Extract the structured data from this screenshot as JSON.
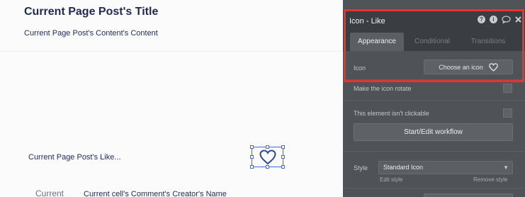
{
  "canvas": {
    "page_title": "Current Page Post's Title",
    "page_content": "Current Page Post's Content's Content",
    "like_text": "Current Page Post's Like...",
    "comment_left": "Current",
    "comment_name": "Current cell's Comment's Creator's Name"
  },
  "panel": {
    "title": "Icon - Like",
    "header_icons": [
      "help-icon",
      "info-icon",
      "comment-icon",
      "close-icon"
    ],
    "tabs": [
      {
        "label": "Appearance",
        "active": true
      },
      {
        "label": "Conditional",
        "active": false
      },
      {
        "label": "Transitions",
        "active": false
      }
    ],
    "icon_row": {
      "label": "Icon",
      "button_label": "Choose an icon",
      "button_icon": "heart-icon"
    },
    "rotate_label": "Make the icon rotate",
    "clickable_label": "This element isn't clickable",
    "workflow_button": "Start/Edit workflow",
    "style_row": {
      "label": "Style",
      "selected": "Standard Icon",
      "edit_link": "Edit style",
      "remove_link": "Remove style"
    }
  },
  "colors": {
    "panel_bg": "#4f5257",
    "panel_header": "#3a3d42",
    "highlight": "#e8322e",
    "selection": "#3a6fd8",
    "canvas_text": "#1f2a4d"
  }
}
